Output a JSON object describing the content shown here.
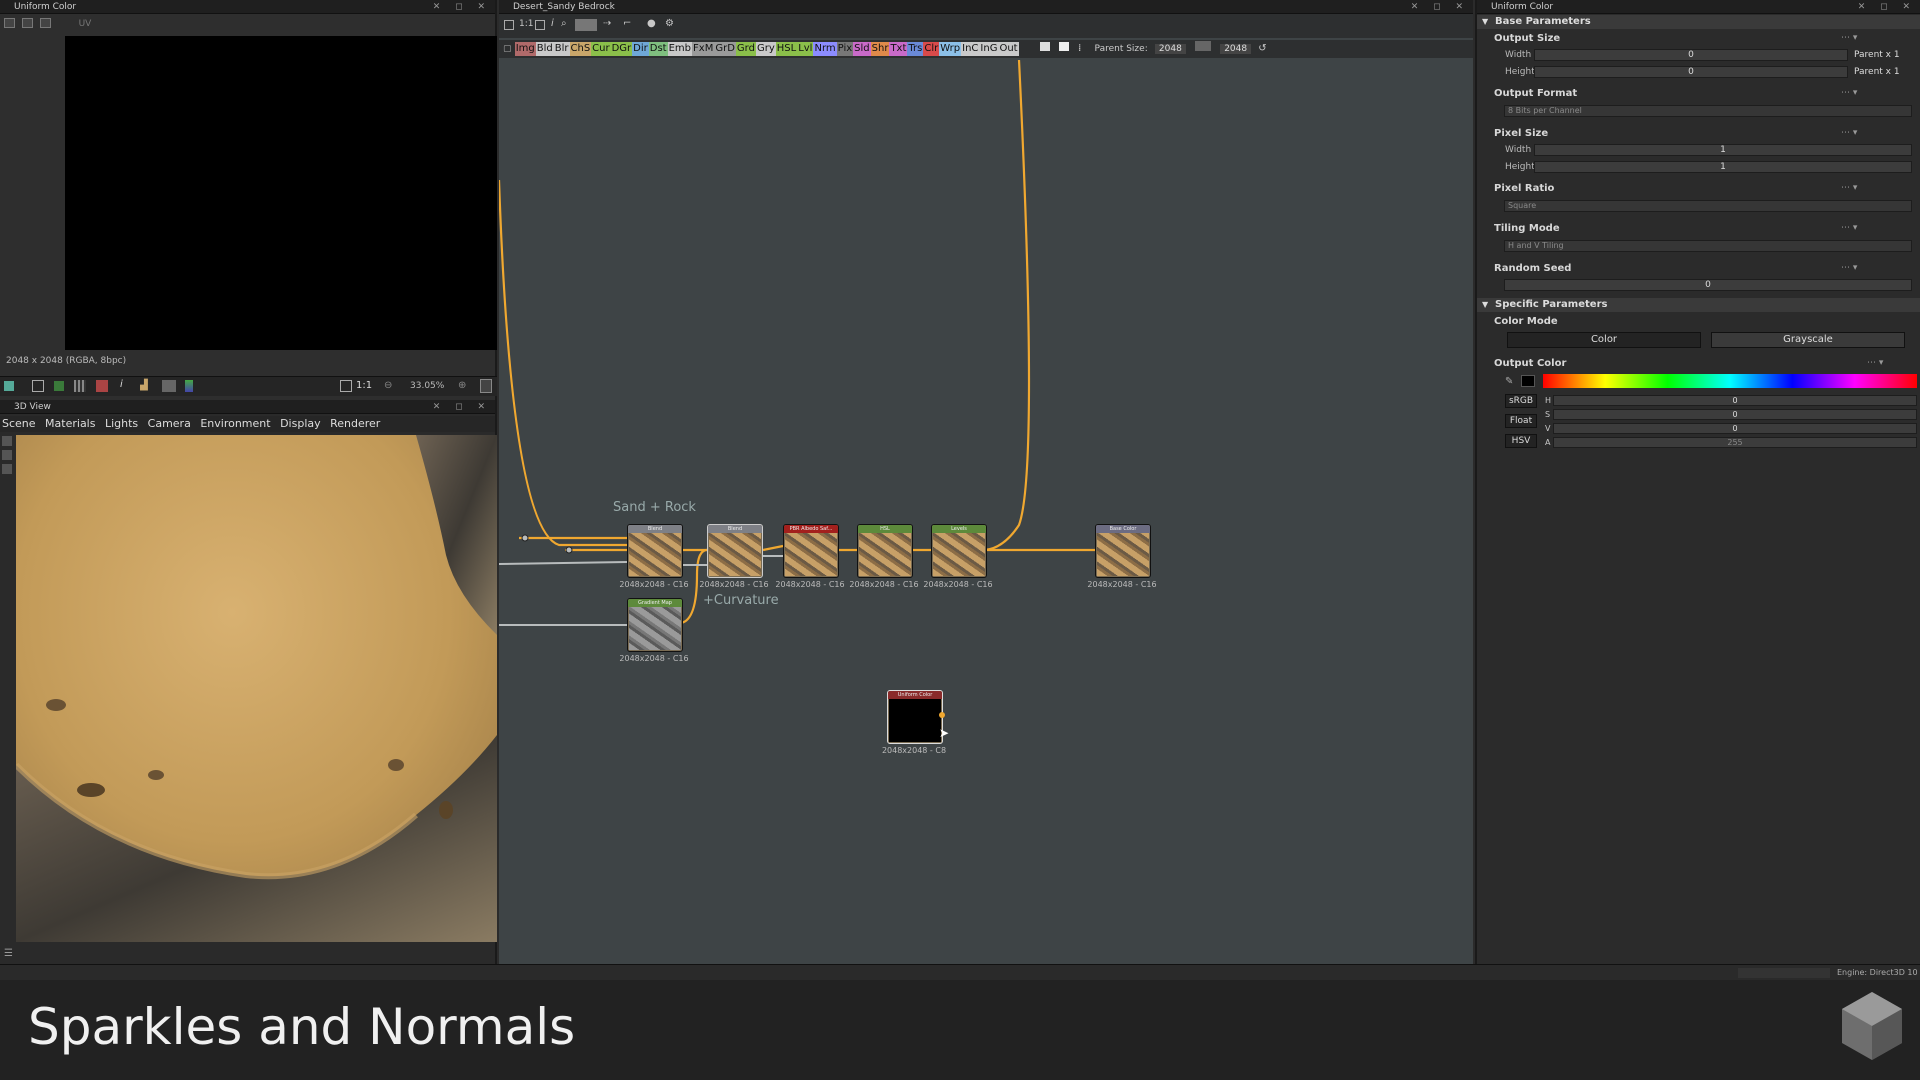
{
  "view2d": {
    "title": "Uniform Color",
    "resolution": "2048 x 2048 (RGBA, 8bpc)",
    "zoom": "33.05%",
    "ratio": "1:1",
    "tool_hint": "UV"
  },
  "view3d": {
    "title": "3D View",
    "menu": [
      "Scene",
      "Materials",
      "Lights",
      "Camera",
      "Environment",
      "Display",
      "Renderer"
    ]
  },
  "graph": {
    "title": "Desert_Sandy Bedrock",
    "library_tags": [
      {
        "label": "Img",
        "color": "#b06a6a"
      },
      {
        "label": "Bld",
        "color": "#c9c9c9"
      },
      {
        "label": "Blr",
        "color": "#c9c9c9"
      },
      {
        "label": "ChS",
        "color": "#c9a66a"
      },
      {
        "label": "Cur",
        "color": "#8bbf4a"
      },
      {
        "label": "DGr",
        "color": "#8bbf4a"
      },
      {
        "label": "Dir",
        "color": "#6fa8d8"
      },
      {
        "label": "Dst",
        "color": "#7fbf7f"
      },
      {
        "label": "Emb",
        "color": "#c9c9c9"
      },
      {
        "label": "FxM",
        "color": "#9a9a9a"
      },
      {
        "label": "GrD",
        "color": "#9a9a9a"
      },
      {
        "label": "Grd",
        "color": "#8bbf4a"
      },
      {
        "label": "Gry",
        "color": "#c9c9c9"
      },
      {
        "label": "HSL",
        "color": "#8bbf4a"
      },
      {
        "label": "Lvl",
        "color": "#8bbf4a"
      },
      {
        "label": "Nrm",
        "color": "#8c8cff"
      },
      {
        "label": "Pix",
        "color": "#777777"
      },
      {
        "label": "Sld",
        "color": "#c96ac9"
      },
      {
        "label": "Shr",
        "color": "#e08a4a"
      },
      {
        "label": "Txt",
        "color": "#c96ac9"
      },
      {
        "label": "Trs",
        "color": "#6a8ad8"
      },
      {
        "label": "Clr",
        "color": "#d84a4a"
      },
      {
        "label": "Wrp",
        "color": "#8cc0e8"
      },
      {
        "label": "InC",
        "color": "#c9c9c9"
      },
      {
        "label": "InG",
        "color": "#c9c9c9"
      },
      {
        "label": "Out",
        "color": "#c9c9c9"
      }
    ],
    "parent_size_label": "Parent Size:",
    "parent_size_value": "2048",
    "size_value": "2048",
    "comments": {
      "sand_rock": "Sand + Rock",
      "curvature": "+Curvature"
    },
    "nodes": [
      {
        "name": "Blend",
        "res": "2048x2048 - C16",
        "hdr": "#7e8086"
      },
      {
        "name": "Blend",
        "res": "2048x2048 - C16",
        "hdr": "#7e8086"
      },
      {
        "name": "PBR Albedo Saf...",
        "res": "2048x2048 - C16",
        "hdr": "#a3201d"
      },
      {
        "name": "HSL",
        "res": "2048x2048 - C16",
        "hdr": "#5d8a3b"
      },
      {
        "name": "Levels",
        "res": "2048x2048 - C16",
        "hdr": "#5d8a3b"
      },
      {
        "name": "Base Color",
        "res": "2048x2048 - C16",
        "hdr": "#6c6c82"
      },
      {
        "name": "Gradient Map",
        "res": "2048x2048 - C16",
        "hdr": "#5d8a3b"
      },
      {
        "name": "Uniform Color",
        "res": "2048x2048 - C8",
        "hdr": "#8a2b2b"
      }
    ]
  },
  "props": {
    "title": "Uniform Color",
    "base_section": "Base Parameters",
    "output_size": {
      "label": "Output Size",
      "width_label": "Width",
      "height_label": "Height",
      "width_value": "0",
      "height_value": "0",
      "width_rel": "Parent x 1",
      "height_rel": "Parent x 1"
    },
    "output_format": {
      "label": "Output Format",
      "value": "8 Bits per Channel"
    },
    "pixel_size": {
      "label": "Pixel Size",
      "width_label": "Width",
      "height_label": "Height",
      "width_value": "1",
      "height_value": "1"
    },
    "pixel_ratio": {
      "label": "Pixel Ratio",
      "value": "Square"
    },
    "tiling_mode": {
      "label": "Tiling Mode",
      "value": "H and V Tiling"
    },
    "random_seed": {
      "label": "Random Seed",
      "value": "0"
    },
    "specific_section": "Specific Parameters",
    "color_mode": {
      "label": "Color Mode",
      "color": "Color",
      "grayscale": "Grayscale"
    },
    "output_color": {
      "label": "Output Color",
      "srgb": "sRGB",
      "float": "Float",
      "hsv": "HSV",
      "h_label": "H",
      "s_label": "S",
      "v_label": "V",
      "a_label": "A",
      "h": "0",
      "s": "0",
      "v": "0",
      "a": "255"
    }
  },
  "status": {
    "engine": "Engine: Direct3D 10"
  },
  "footer": {
    "title": "Sparkles and Normals"
  }
}
